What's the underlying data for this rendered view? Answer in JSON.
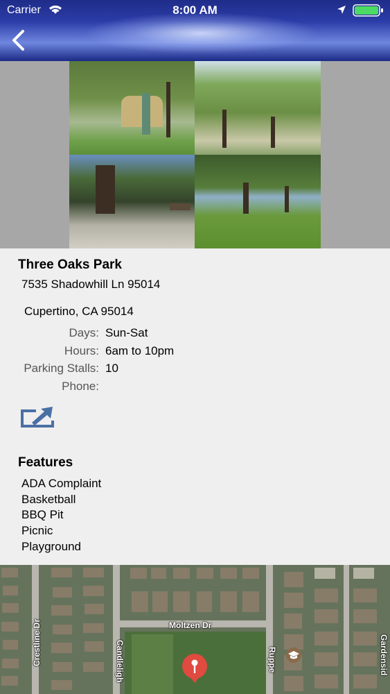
{
  "status_bar": {
    "carrier": "Carrier",
    "time": "8:00 AM"
  },
  "park": {
    "name": "Three Oaks Park",
    "address_line1": "7535 Shadowhill Ln 95014",
    "address_line2": "Cupertino, CA 95014"
  },
  "details": [
    {
      "label": "Days:",
      "value": "Sun-Sat"
    },
    {
      "label": "Hours:",
      "value": "6am to 10pm"
    },
    {
      "label": "Parking Stalls:",
      "value": "10"
    },
    {
      "label": "Phone:",
      "value": ""
    }
  ],
  "features": {
    "title": "Features",
    "items": [
      "ADA Complaint",
      "Basketball",
      "BBQ Pit",
      "Picnic",
      "Playground"
    ]
  },
  "map": {
    "streets": [
      "Crestline Dr",
      "Candleligh",
      "Moltzen Dr",
      "Ruppe",
      "Gardensid"
    ]
  },
  "colors": {
    "nav_gradient_top": "#1f2c88",
    "nav_gradient_bottom": "#1a2a86",
    "share_icon": "#4a6fa5",
    "pin": "#e04a3f"
  }
}
